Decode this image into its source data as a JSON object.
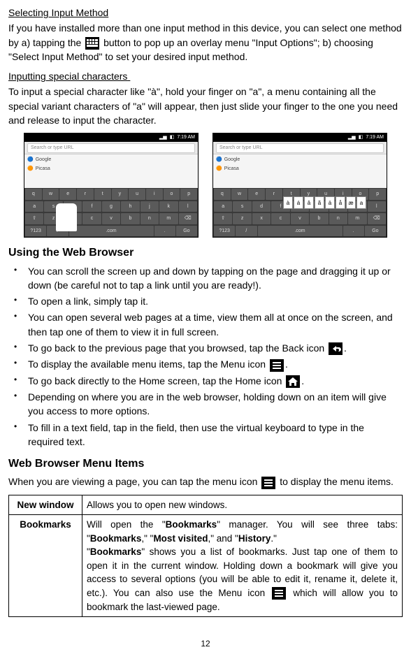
{
  "section1": {
    "title": "Selecting Input Method",
    "body_before": "If you have installed more than one input method in this device, you can select one method by a) tapping the ",
    "body_after": " button to pop up an overlay menu \"Input Options\"; b) choosing \"Select Input Method\" to set your desired input method."
  },
  "section2": {
    "title": "Inputting special characters",
    "body": "To input a special character like \"à\", hold your finger on \"a\", a menu containing all the special variant characters of \"a\" will appear, then just slide your finger to the one you need and release to input the character."
  },
  "screenshot_time": "7:19 AM",
  "screenshot_urlplaceholder": "Search or type URL",
  "screenshot_site1": "Google",
  "screenshot_site2": "Picasa",
  "popup_chars": [
    "à",
    "á",
    "â",
    "ã",
    "ä",
    "å",
    "æ",
    "a"
  ],
  "h2a": "Using the Web Browser",
  "bullets": {
    "b1": "You can scroll the screen up and down by tapping on the page and dragging it up or down (be careful not to tap a link until you are ready!).",
    "b2": "To open a link, simply tap it.",
    "b3": "You can open several web pages at a time, view them all at once on the screen, and then tap one of them to view it in full screen.",
    "b4a": "To go back to the previous page that you browsed, tap the Back icon ",
    "b4b": ".",
    "b5a": "To display the available menu items, tap the Menu icon ",
    "b5b": ".",
    "b6a": "To go back directly to the Home screen, tap the Home icon ",
    "b6b": ".",
    "b7": "Depending on where you are in the web browser, holding down on an item will give you access to more options.",
    "b8": "To fill in a text field, tap in the field, then use the virtual keyboard to type in the required text."
  },
  "h2b": "Web Browser Menu Items",
  "menu_intro_a": "When you are viewing a page, you can tap the menu icon ",
  "menu_intro_b": " to display the menu items.",
  "table": {
    "r1label": "New window",
    "r1desc": "Allows you to open new windows.",
    "r2label": "Bookmarks",
    "r2_p1a": "Will open the \"",
    "r2_p1b": "Bookmarks",
    "r2_p1c": "\" manager. You will see three tabs: \"",
    "r2_p1d": "Bookmarks",
    "r2_p1e": ",\" \"",
    "r2_p1f": "Most visited",
    "r2_p1g": ",\" and \"",
    "r2_p1h": "History",
    "r2_p1i": ".\"",
    "r2_p2a": "\"",
    "r2_p2b": "Bookmarks",
    "r2_p2c": "\" shows you a list of bookmarks. Just tap one of them to open it in the current window. Holding down a bookmark will give you access to several options (you will be able to edit it, rename it, delete it, etc.). You can also use the Menu icon ",
    "r2_p2d": " which will allow you to bookmark the last-viewed page."
  },
  "page_number": "12"
}
